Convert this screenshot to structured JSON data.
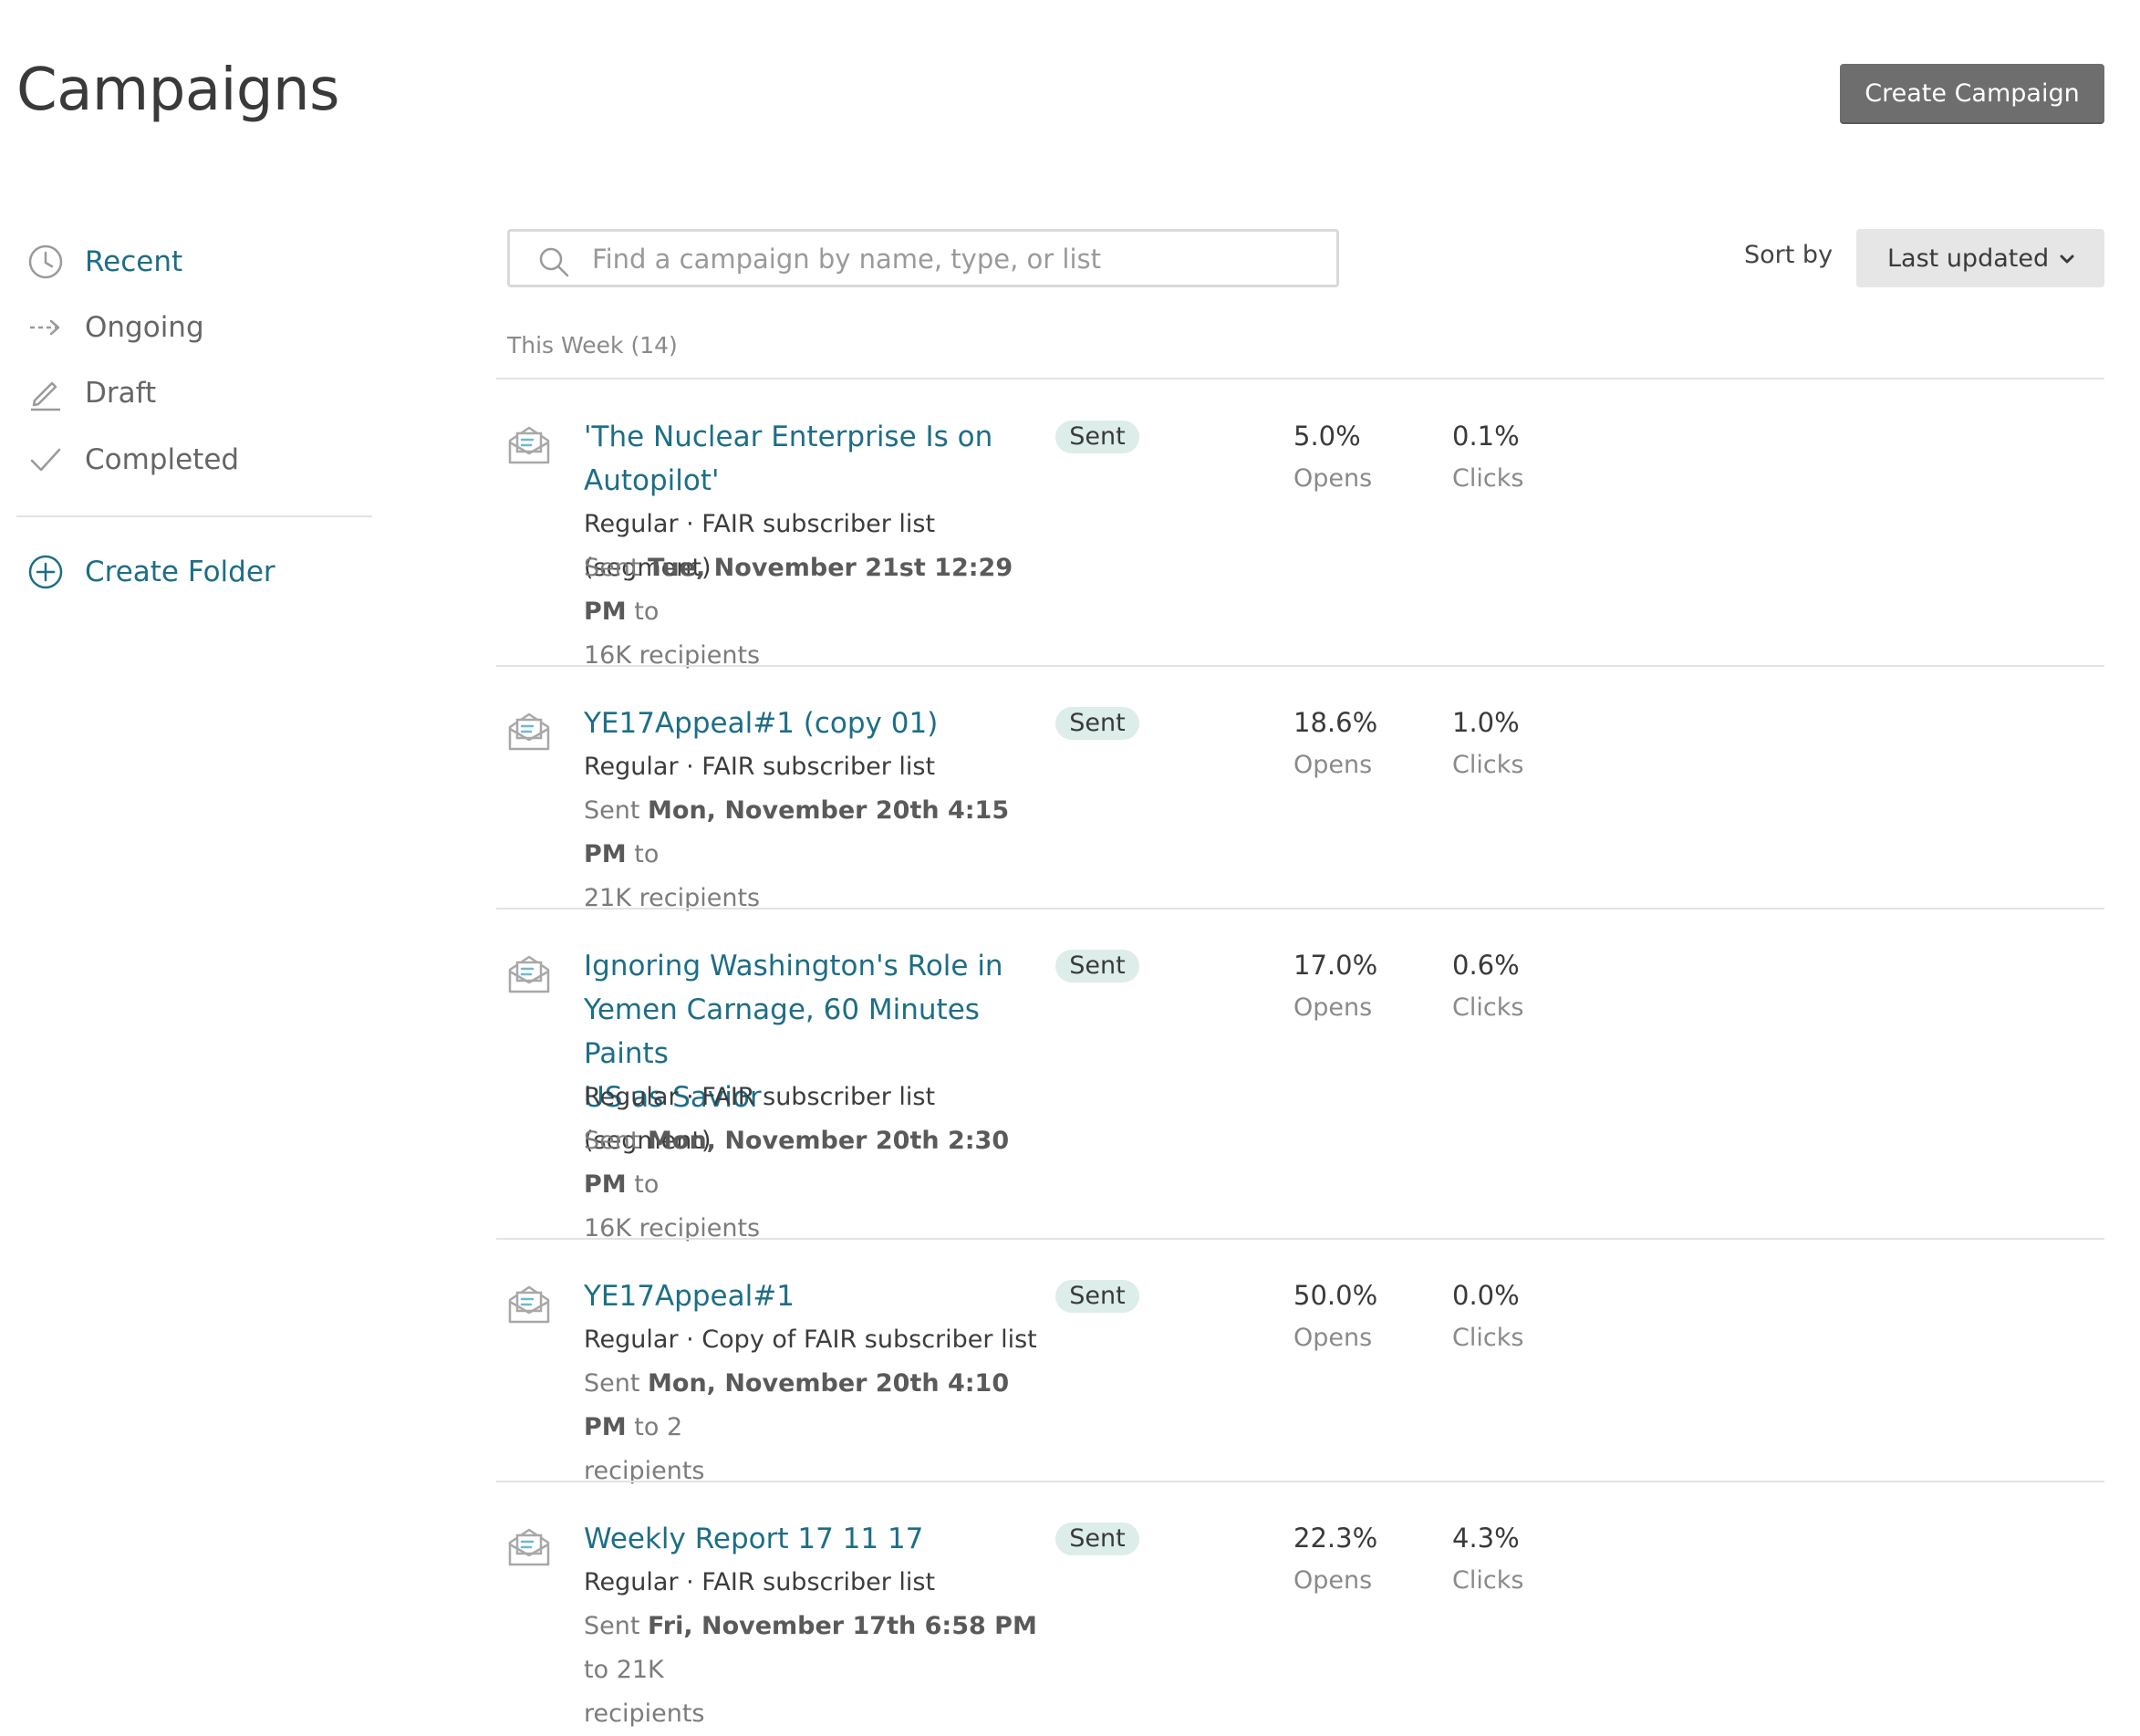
{
  "header": {
    "title": "Campaigns",
    "create_label": "Create Campaign"
  },
  "sidebar": {
    "items": [
      {
        "label": "Recent",
        "icon": "clock-icon",
        "active": true
      },
      {
        "label": "Ongoing",
        "icon": "dashed-arrow-right-icon",
        "active": false
      },
      {
        "label": "Draft",
        "icon": "pencil-icon",
        "active": false
      },
      {
        "label": "Completed",
        "icon": "checkmark-icon",
        "active": false
      }
    ],
    "create_folder_label": "Create Folder"
  },
  "search": {
    "placeholder": "Find a campaign by name, type, or list",
    "value": ""
  },
  "sort": {
    "label": "Sort by",
    "selected": "Last updated"
  },
  "group": {
    "label": "This Week (14)"
  },
  "campaigns": [
    {
      "title_lines": [
        "'The Nuclear Enterprise Is on",
        "Autopilot'"
      ],
      "status": "Sent",
      "meta": "Regular · FAIR subscriber list (segment)",
      "sent_prefix": "Sent ",
      "sent_date": "Tue, November 21st 12:29 PM",
      "sent_suffix_line1": " to",
      "sent_line2": "16K recipients",
      "opens": "5.0%",
      "opens_label": "Opens",
      "clicks": "0.1%",
      "clicks_label": "Clicks"
    },
    {
      "title_lines": [
        "YE17Appeal#1 (copy 01)"
      ],
      "status": "Sent",
      "meta": "Regular · FAIR subscriber list",
      "sent_prefix": "Sent ",
      "sent_date": "Mon, November 20th 4:15 PM",
      "sent_suffix_line1": " to",
      "sent_line2": "21K recipients",
      "opens": "18.6%",
      "opens_label": "Opens",
      "clicks": "1.0%",
      "clicks_label": "Clicks"
    },
    {
      "title_lines": [
        "Ignoring Washington's Role in",
        "Yemen Carnage, 60 Minutes Paints",
        "US as Savior"
      ],
      "status": "Sent",
      "meta": "Regular · FAIR subscriber list (segment)",
      "sent_prefix": "Sent ",
      "sent_date": "Mon, November 20th 2:30 PM",
      "sent_suffix_line1": " to",
      "sent_line2": "16K recipients",
      "opens": "17.0%",
      "opens_label": "Opens",
      "clicks": "0.6%",
      "clicks_label": "Clicks"
    },
    {
      "title_lines": [
        "YE17Appeal#1"
      ],
      "status": "Sent",
      "meta": "Regular · Copy of FAIR subscriber list",
      "sent_prefix": "Sent ",
      "sent_date": "Mon, November 20th 4:10 PM",
      "sent_suffix_line1": " to 2",
      "sent_line2": "recipients",
      "opens": "50.0%",
      "opens_label": "Opens",
      "clicks": "0.0%",
      "clicks_label": "Clicks"
    },
    {
      "title_lines": [
        "Weekly Report 17 11 17"
      ],
      "status": "Sent",
      "meta": "Regular · FAIR subscriber list",
      "sent_prefix": "Sent ",
      "sent_date": "Fri, November 17th 6:58 PM",
      "sent_suffix_line1": " to 21K",
      "sent_line2": "recipients",
      "opens": "22.3%",
      "opens_label": "Opens",
      "clicks": "4.3%",
      "clicks_label": "Clicks"
    }
  ]
}
